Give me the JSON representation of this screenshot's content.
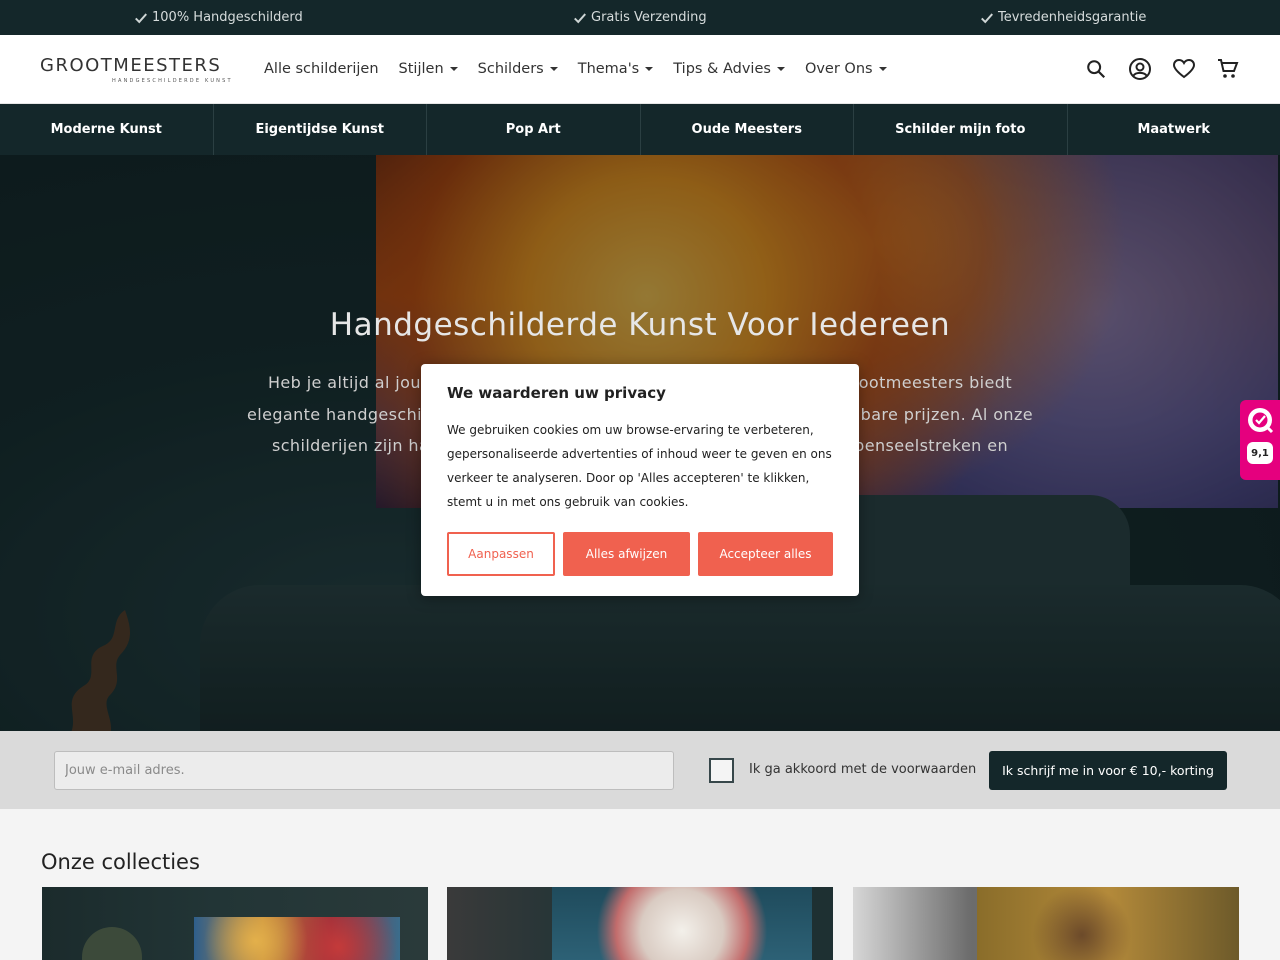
{
  "usp": {
    "items": [
      "100% Handgeschilderd",
      "Gratis Verzending",
      "Tevredenheidsgarantie"
    ]
  },
  "header": {
    "logo_text": "GROOTMEESTERS",
    "logo_sub": "HANDGESCHILDERDE KUNST",
    "nav": [
      {
        "label": "Alle schilderijen",
        "dropdown": false
      },
      {
        "label": "Stijlen",
        "dropdown": true
      },
      {
        "label": "Schilders",
        "dropdown": true
      },
      {
        "label": "Thema's",
        "dropdown": true
      },
      {
        "label": "Tips & Advies",
        "dropdown": true
      },
      {
        "label": "Over Ons",
        "dropdown": true
      }
    ],
    "icons": [
      "search-icon",
      "account-icon",
      "heart-icon",
      "cart-icon"
    ]
  },
  "categories": [
    "Moderne Kunst",
    "Eigentijdse Kunst",
    "Pop Art",
    "Oude Meesters",
    "Schilder mijn foto",
    "Maatwerk"
  ],
  "hero": {
    "title": "Handgeschilderde Kunst Voor Iedereen",
    "text_lines": [
      "Heb je altijd al jouw",
      "elegante handgeschilde",
      "schilderijen zijn ha"
    ],
    "text_lines_right": [
      "Grootmeesters biedt",
      "taalbare prijzen. Al onze",
      "penseelstreken en"
    ]
  },
  "cookie": {
    "title": "We waarderen uw privacy",
    "text": "We gebruiken cookies om uw browse-ervaring te verbeteren, gepersonaliseerde advertenties of inhoud weer te geven en ons verkeer te analyseren. Door op 'Alles accepteren' te klikken, stemt u in met ons gebruik van cookies.",
    "customize_label": "Aanpassen",
    "reject_label": "Alles afwijzen",
    "accept_label": "Accepteer alles",
    "accent_color": "#f0614f"
  },
  "review_badge": {
    "score": "9,1",
    "color": "#e5007e"
  },
  "newsletter": {
    "placeholder": "Jouw e-mail adres.",
    "checkbox_label": "Ik ga akkoord met de voorwaarden",
    "subscribe_label": "Ik schrijf me in voor € 10,- korting"
  },
  "collections": {
    "title": "Onze collecties"
  },
  "colors": {
    "dark": "#14272a"
  }
}
